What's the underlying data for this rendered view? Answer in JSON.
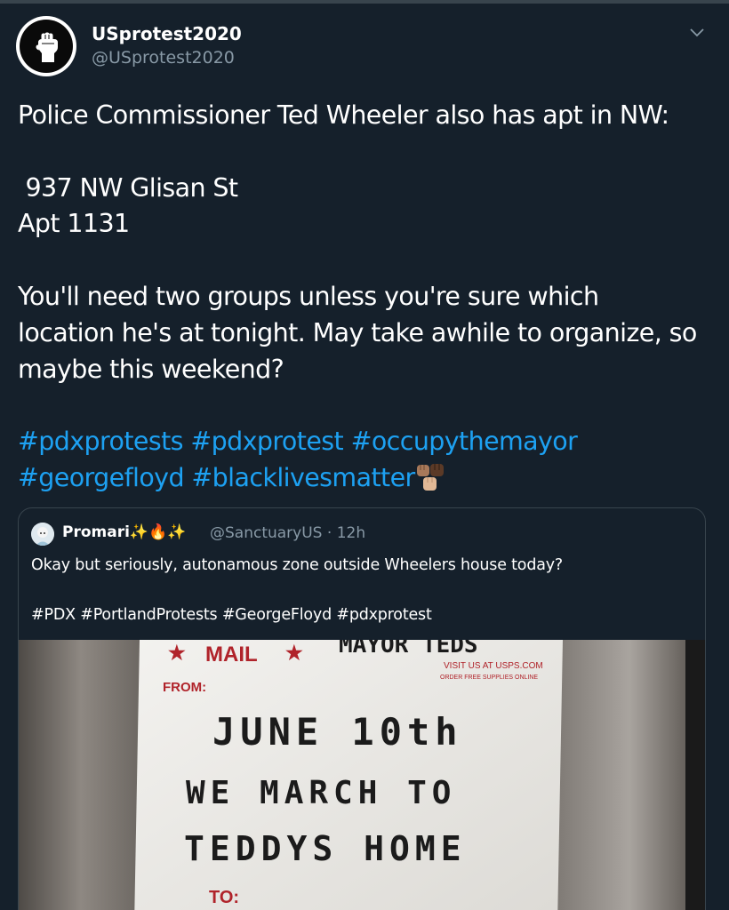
{
  "tweet": {
    "display_name": "USprotest2020",
    "handle": "@USprotest2020",
    "body_lines": [
      "Police Commissioner Ted Wheeler also has apt in NW:",
      "",
      " 937 NW Glisan St",
      "Apt 1131",
      "",
      "You'll need two groups unless you're sure which",
      "location he's at tonight. May take awhile to organize, so",
      "maybe this weekend?",
      ""
    ],
    "hashtags_line1": [
      "#pdxprotests",
      "#pdxprotest",
      "#occupythemayor"
    ],
    "hashtags_line2": [
      "#georgefloyd",
      "#blacklivesmatter"
    ],
    "emoji": "raised-fists-emoji"
  },
  "quoted": {
    "display_name": "Promari",
    "name_emoji": [
      "sparkles",
      "fire",
      "sparkles"
    ],
    "handle": "@SanctuaryUS",
    "separator": "·",
    "time": "12h",
    "text_line1": "Okay but seriously, autonamous zone outside Wheelers house today?",
    "text_line3": "#PDX #PortlandProtests #GeorgeFloyd #pdxprotest",
    "image": {
      "label_from": "FROM:",
      "label_to": "TO:",
      "handwriting_line1": "JUNE 10th",
      "handwriting_line2": "WE MARCH TO",
      "handwriting_line3": "TEDDYS HOME",
      "header_scrawl": "MAYOR TEDS",
      "stamp_text": "VISIT US AT USPS.COM",
      "stamp_text2": "ORDER FREE SUPPLIES ONLINE"
    }
  },
  "colors": {
    "background": "#15202b",
    "link": "#1da1f2",
    "secondary_text": "#8899a6",
    "border": "#38444d"
  },
  "icons": {
    "caret": "chevron-down-icon",
    "avatar": "raised-fist-logo"
  }
}
